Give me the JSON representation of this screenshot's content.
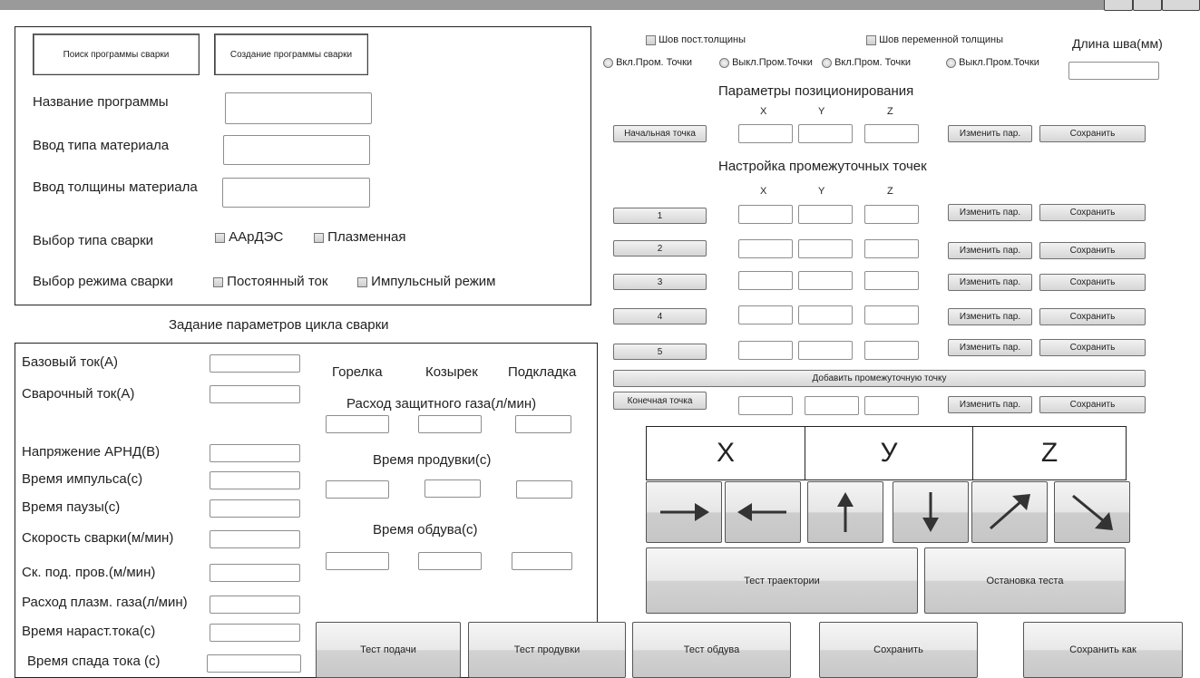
{
  "left_panel": {
    "search_button": "Поиск программы сварки",
    "create_button": "Создание программы сварки",
    "program_name_label": "Название программы",
    "material_type_label": "Ввод типа материала",
    "material_thickness_label": "Ввод толщины материала",
    "welding_type_label": "Выбор типа сварки",
    "welding_type_options": [
      "ААрДЭС",
      "Плазменная"
    ],
    "welding_mode_label": "Выбор режима сварки",
    "welding_mode_options": [
      "Постоянный ток",
      "Импульсный режим"
    ]
  },
  "cycle": {
    "title": "Задание параметров цикла сварки",
    "params": [
      "Базовый ток(А)",
      "Сварочный ток(А)",
      "Напряжение АРНД(В)",
      "Время импульса(с)",
      "Время паузы(с)",
      "Скорость сварки(м/мин)",
      "Ск. под. пров.(м/мин)",
      "Расход плазм. газа(л/мин)",
      "Время нараст.тока(с)",
      "Время спада тока (с)"
    ],
    "gas_columns": [
      "Горелка",
      "Козырек",
      "Подкладка"
    ],
    "gas_flow_label": "Расход защитного газа(л/мин)",
    "purge_time_label": "Время продувки(с)",
    "blow_time_label": "Время обдува(с)"
  },
  "seam": {
    "const_thickness": "Шов пост.толщины",
    "var_thickness": "Шов переменной толщины",
    "length_label": "Длина шва(мм)",
    "radios": [
      "Вкл.Пром. Точки",
      "Выкл.Пром.Точки",
      "Вкл.Пром. Точки",
      "Выкл.Пром.Точки"
    ]
  },
  "positioning": {
    "title": "Параметры позиционирования",
    "axes": [
      "X",
      "Y",
      "Z"
    ],
    "start_point": "Начальная точка",
    "change_btn": "Изменить пар.",
    "save_btn": "Сохранить"
  },
  "intermediate": {
    "title": "Настройка промежуточных точек",
    "axes": [
      "X",
      "Y",
      "Z"
    ],
    "points": [
      "1",
      "2",
      "3",
      "4",
      "5"
    ],
    "change_btn": "Изменить пар.",
    "save_btn": "Сохранить",
    "add_point": "Добавить промежуточную точку",
    "end_point": "Конечная точка"
  },
  "axis_grid": [
    "X",
    "У",
    "Z"
  ],
  "arrows": [
    "arrow-right-icon",
    "arrow-left-icon",
    "arrow-up-icon",
    "arrow-down-icon",
    "arrow-up-right-icon",
    "arrow-down-right-icon"
  ],
  "test_buttons": {
    "trajectory": "Тест траектории",
    "stop": "Остановка теста"
  },
  "bottom_buttons": [
    "Тест подачи",
    "Тест продувки",
    "Тест обдува",
    "Сохранить",
    "Сохранить как"
  ]
}
